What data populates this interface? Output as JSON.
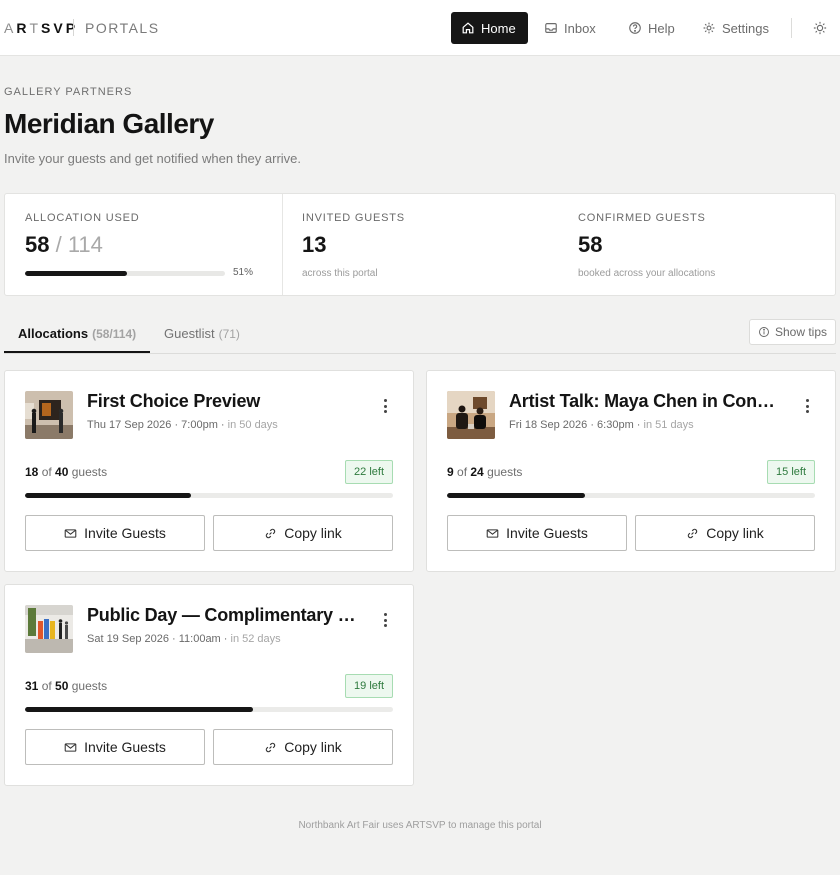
{
  "header": {
    "logo_faint_a": "A",
    "logo_strong_r": "R",
    "logo_faint_t": "T",
    "logo_strong_svp": "SVP",
    "section": "PORTALS",
    "nav": [
      {
        "label": "Home",
        "icon": "home-icon",
        "active": true
      },
      {
        "label": "Inbox",
        "icon": "inbox-icon",
        "active": false
      },
      {
        "label": "Help",
        "icon": "help-icon",
        "active": false
      },
      {
        "label": "Settings",
        "icon": "gear-icon",
        "active": false
      }
    ],
    "theme_icon": "sun-icon"
  },
  "page": {
    "eyebrow": "GALLERY PARTNERS",
    "title": "Meridian Gallery",
    "subtitle": "Invite your guests and get notified when they arrive."
  },
  "stats": {
    "allocation": {
      "label": "ALLOCATION USED",
      "used": "58",
      "of_text": " / 114",
      "progress": 0.51,
      "percent_text": "51%"
    },
    "invited": {
      "label": "INVITED GUESTS",
      "value": "13",
      "note": "across this portal"
    },
    "confirmed": {
      "label": "CONFIRMED GUESTS",
      "value": "58",
      "note": "booked across your allocations"
    }
  },
  "tabs": [
    {
      "label": "Allocations",
      "count": "(58/114)",
      "active": true
    },
    {
      "label": "Guestlist",
      "count": "(71)",
      "active": false
    }
  ],
  "tips_label": "Show tips",
  "cards": [
    {
      "title": "First Choice Preview",
      "date": "Thu 17 Sep 2026 · 7:00pm ·",
      "relative": "in 50 days",
      "count": "18",
      "of": " of ",
      "total": "40",
      "unit": " guests",
      "left": "22 left",
      "progress": 0.45,
      "invite_label": "Invite Guests",
      "copy_label": "Copy link"
    },
    {
      "title": "Artist Talk: Maya Chen in Conversation",
      "date": "Fri 18 Sep 2026 · 6:30pm ·",
      "relative": "in 51 days",
      "count": "9",
      "of": " of ",
      "total": "24",
      "unit": " guests",
      "left": "15 left",
      "progress": 0.375,
      "invite_label": "Invite Guests",
      "copy_label": "Copy link"
    },
    {
      "title": "Public Day — Complimentary Tickets",
      "date": "Sat 19 Sep 2026 · 11:00am ·",
      "relative": "in 52 days",
      "count": "31",
      "of": " of ",
      "total": "50",
      "unit": " guests",
      "left": "19 left",
      "progress": 0.62,
      "invite_label": "Invite Guests",
      "copy_label": "Copy link"
    }
  ],
  "footer": "Northbank Art Fair uses ARTSVP to manage this portal",
  "colors": {
    "accent": "#161616",
    "badge_bg": "#edf8ef",
    "badge_border": "#a7dcb2",
    "badge_text": "#2e7a3e"
  }
}
